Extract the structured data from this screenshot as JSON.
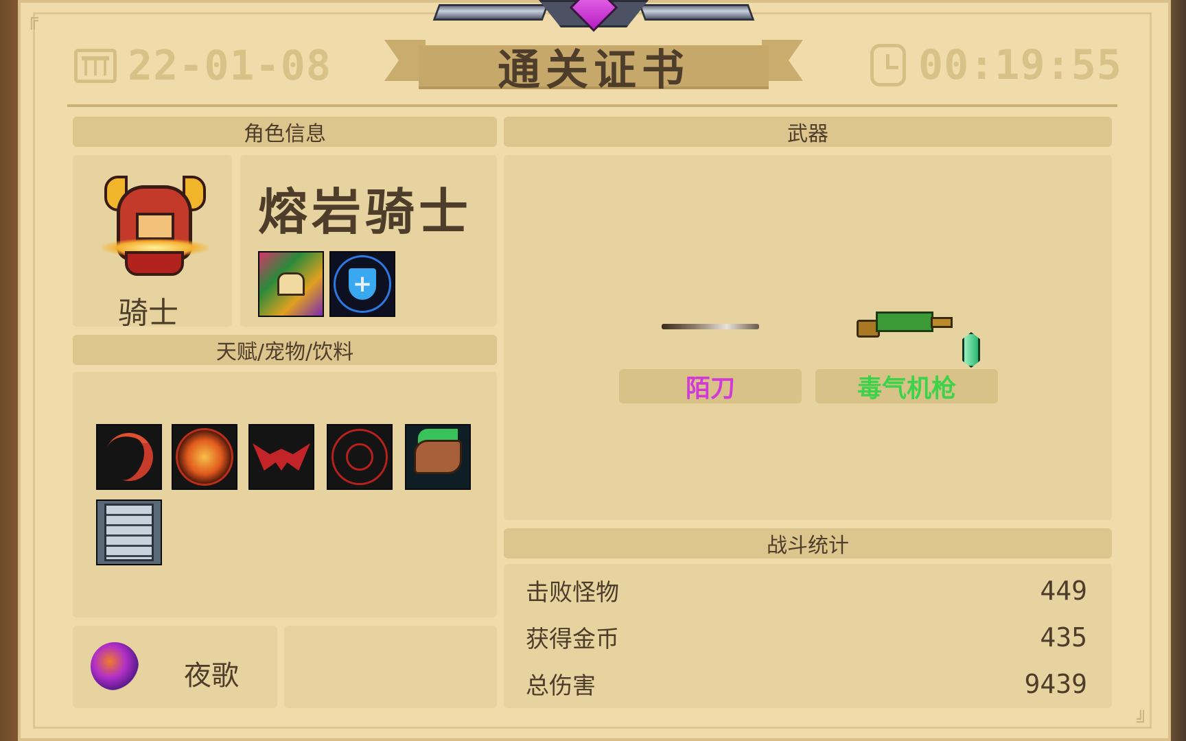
{
  "header": {
    "date": "22-01-08",
    "title": "通关证书",
    "time": "00:19:55"
  },
  "character": {
    "section_title": "角色信息",
    "hero_name": "熔岩骑士",
    "class_name": "骑士",
    "skin_icons": [
      "wizard-hat-icon",
      "shield-cross-icon"
    ]
  },
  "talents": {
    "section_title": "天赋/宠物/饮料",
    "icons": [
      "crescent-blade-icon",
      "fire-swirl-icon",
      "bat-icon",
      "crosshair-icon",
      "green-arm-icon",
      "clipboard-icon"
    ]
  },
  "pet": {
    "name": "夜歌",
    "icon": "purple-bird-icon"
  },
  "weapons": {
    "section_title": "武器",
    "items": [
      {
        "name": "陌刀",
        "color": "#d23ad8",
        "icon": "long-blade-icon"
      },
      {
        "name": "毒气机枪",
        "color": "#3cd24a",
        "icon": "toxic-gun-icon"
      }
    ],
    "gem_icon": "green-crystal-icon"
  },
  "stats": {
    "section_title": "战斗统计",
    "rows": [
      {
        "label": "击败怪物",
        "value": "449"
      },
      {
        "label": "获得金币",
        "value": "435"
      },
      {
        "label": "总伤害",
        "value": "9439"
      }
    ]
  }
}
